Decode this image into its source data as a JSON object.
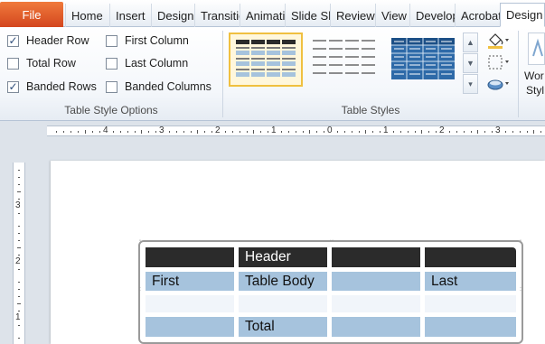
{
  "ribbon_tabs": {
    "file": "File",
    "items": [
      "Home",
      "Insert",
      "Design",
      "Transitions",
      "Animations",
      "Slide Show",
      "Review",
      "View",
      "Developer",
      "Acrobat",
      "Design"
    ]
  },
  "table_style_options": {
    "group_label": "Table Style Options",
    "options": [
      {
        "label": "Header Row",
        "checked": true
      },
      {
        "label": "Total Row",
        "checked": false
      },
      {
        "label": "Banded Rows",
        "checked": true
      },
      {
        "label": "First Column",
        "checked": false
      },
      {
        "label": "Last Column",
        "checked": false
      },
      {
        "label": "Banded Columns",
        "checked": false
      }
    ]
  },
  "table_styles": {
    "group_label": "Table Styles"
  },
  "wordart": {
    "label_line1": "Wor",
    "label_line2": "Styl"
  },
  "ruler": {
    "h_numbers": [
      "4",
      "3",
      "2",
      "1",
      "0",
      "1",
      "2",
      "3"
    ],
    "v_numbers": [
      "3",
      "2",
      "1"
    ]
  },
  "slide_table": {
    "header": "Header",
    "first": "First",
    "table_body": "Table Body",
    "last": "Last",
    "total": "Total"
  },
  "colors": {
    "file_tab": "#d4461e",
    "header_row": "#2b2b2b",
    "banded_row": "#a6c3dd",
    "selection_border": "#f0c040",
    "blue_style": "#2e6aa8"
  }
}
